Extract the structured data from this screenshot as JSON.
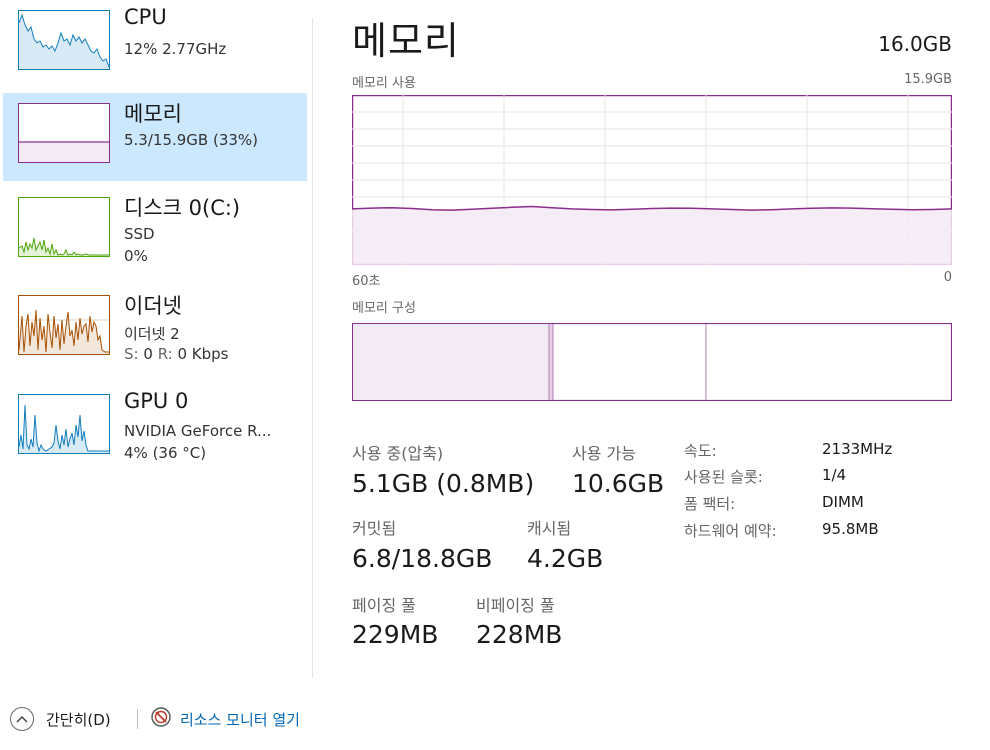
{
  "sidebar": {
    "items": [
      {
        "title": "CPU",
        "line1": "12% 2.77GHz",
        "line2": ""
      },
      {
        "title": "메모리",
        "line1": "5.3/15.9GB (33%)",
        "line2": ""
      },
      {
        "title": "디스크 0(C:)",
        "line1": "SSD",
        "line2": "0%"
      },
      {
        "title": "이더넷",
        "line1": "이더넷 2",
        "line2_s_label": "S:",
        "line2_s_value": "0",
        "line2_r_label": "R:",
        "line2_r_value": "0 Kbps"
      },
      {
        "title": "GPU 0",
        "line1": "NVIDIA GeForce R...",
        "line2": "4% (36 °C)"
      }
    ]
  },
  "main": {
    "title": "메모리",
    "total": "16.0GB",
    "usage_caption": "메모리 사용",
    "usage_max": "15.9GB",
    "time_left": "60초",
    "time_right": "0",
    "composition_caption": "메모리 구성",
    "usage_fraction": 0.33,
    "stats": {
      "in_use_label": "사용 중(압축)",
      "in_use_value": "5.1GB (0.8MB)",
      "available_label": "사용 가능",
      "available_value": "10.6GB",
      "committed_label": "커밋됨",
      "committed_value": "6.8/18.8GB",
      "cached_label": "캐시됨",
      "cached_value": "4.2GB",
      "paged_label": "페이징 풀",
      "paged_value": "229MB",
      "nonpaged_label": "비페이징 풀",
      "nonpaged_value": "228MB"
    },
    "details": [
      {
        "label": "속도:",
        "value": "2133MHz"
      },
      {
        "label": "사용된 슬롯:",
        "value": "1/4"
      },
      {
        "label": "폼 팩터:",
        "value": "DIMM"
      },
      {
        "label": "하드웨어 예약:",
        "value": "95.8MB"
      }
    ]
  },
  "footer": {
    "fewer_details": "간단히(D)",
    "resource_monitor": "리소스 모니터 열기"
  },
  "colors": {
    "memory_accent": "#8b2e8b",
    "memory_fill": "#f4eaf4",
    "cpu_accent": "#117dbb",
    "disk_accent": "#4da60c",
    "ethernet_accent": "#a74f01",
    "gpu_accent": "#117dbb",
    "selected_bg": "#cce8ff",
    "link": "#0066b4"
  },
  "icons": {
    "fewer_details": "chevron-up-icon",
    "resource_monitor": "resource-monitor-icon"
  }
}
